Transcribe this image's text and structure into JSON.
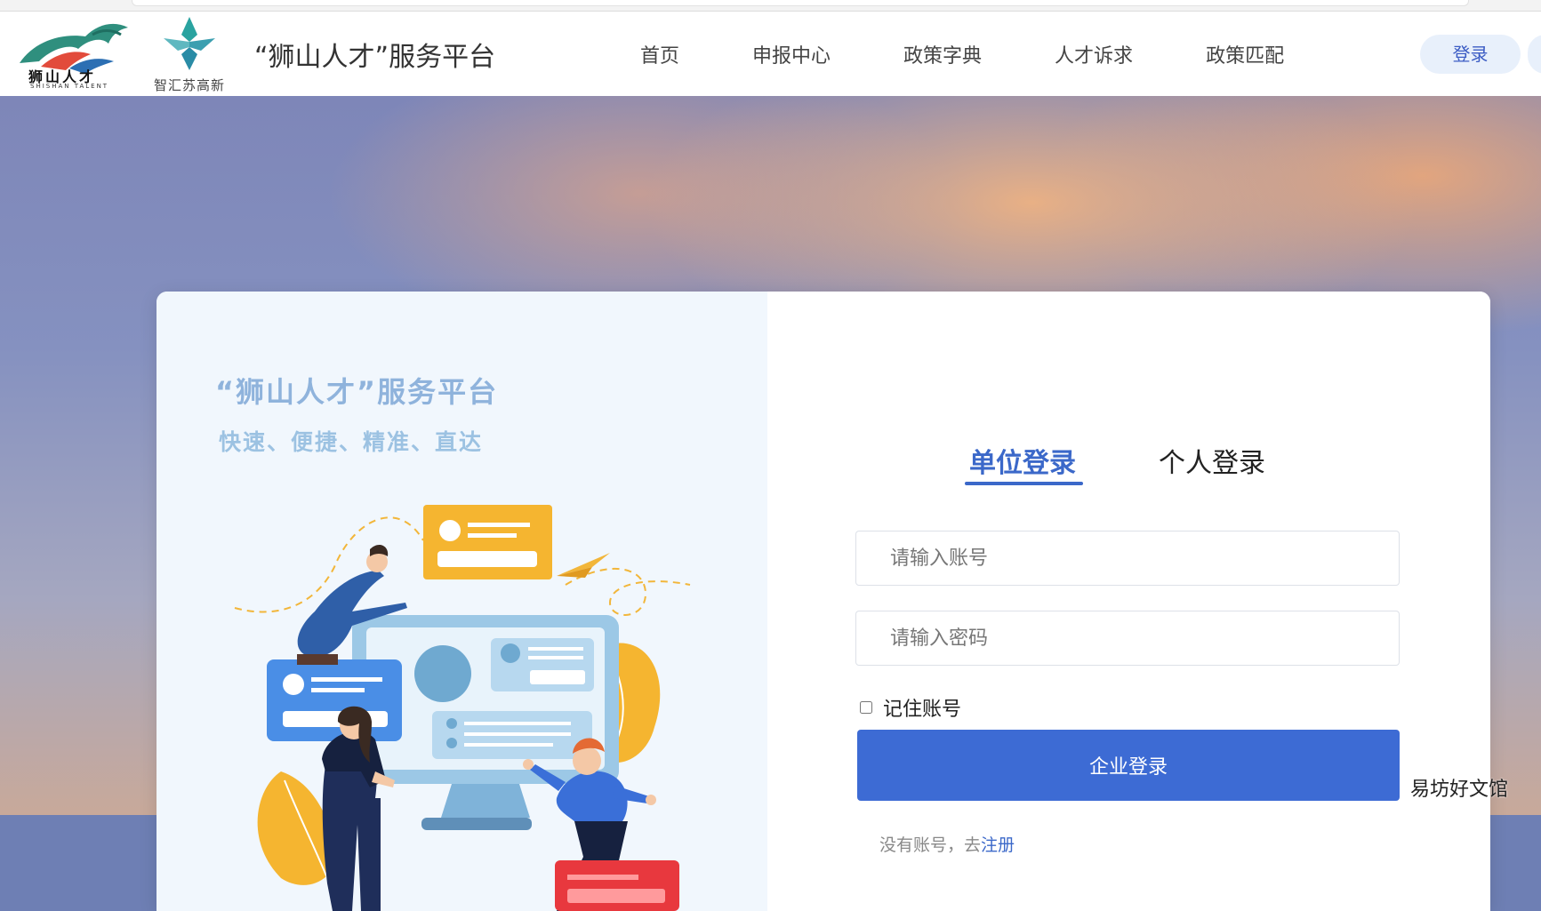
{
  "header": {
    "logo1_text": "狮山人才",
    "logo1_sub": "SHISHAN TALENT",
    "logo2_caption": "智汇苏高新",
    "site_title": "“狮山人才”服务平台",
    "nav": [
      "首页",
      "申报中心",
      "政策字典",
      "人才诉求",
      "政策匹配"
    ],
    "login_button": "登录"
  },
  "promo": {
    "title": "“狮山人才”服务平台",
    "subtitle": "快速、便捷、精准、直达"
  },
  "login": {
    "tabs": [
      "单位登录",
      "个人登录"
    ],
    "active_tab": "单位登录",
    "account_placeholder": "请输入账号",
    "password_placeholder": "请输入密码",
    "remember_label": "记住账号",
    "remember_checked": false,
    "submit_label": "企业登录",
    "register_prompt": "没有账号，去",
    "register_link": "注册"
  },
  "watermark": "易坊好文馆",
  "colors": {
    "accent": "#3d6bd4",
    "tab_active": "#3b68c9",
    "promo_title": "#8fb3dc",
    "pill_bg": "#e8f0fb"
  }
}
